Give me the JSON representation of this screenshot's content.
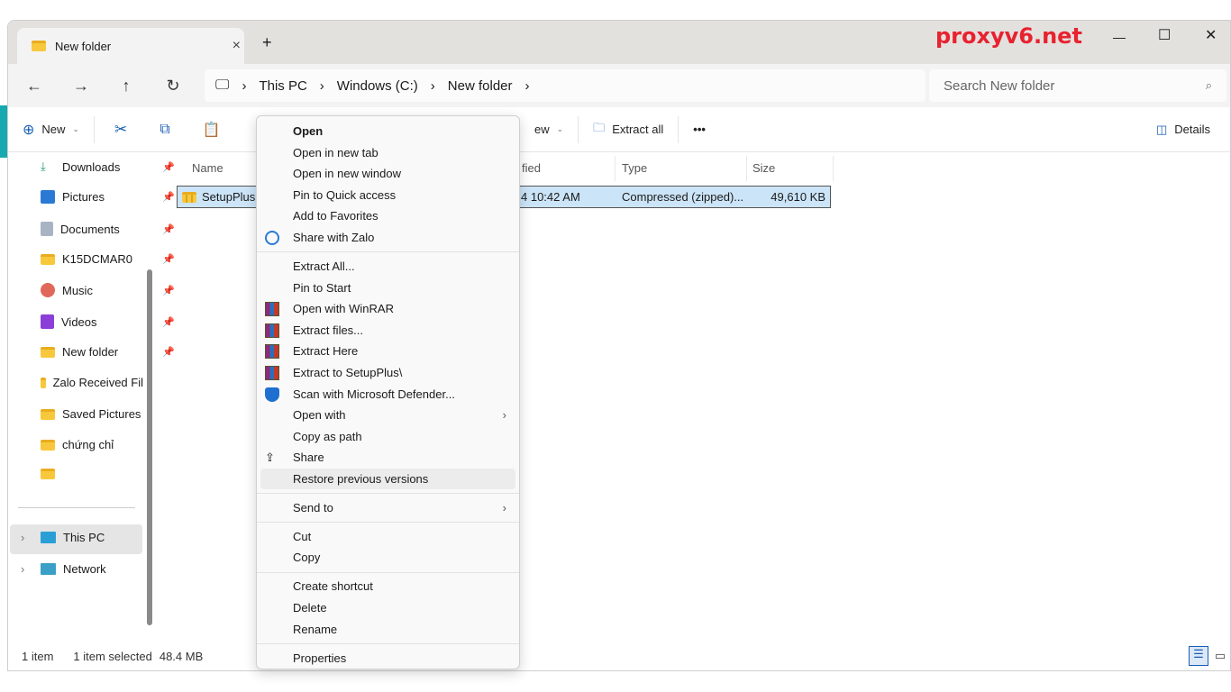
{
  "brand": "proxyv6.net",
  "tab": {
    "title": "New folder",
    "close": "×",
    "new": "+"
  },
  "window": {
    "minimize": "—",
    "maximize": "☐",
    "close": "✕"
  },
  "nav": {
    "back": "←",
    "forward": "→",
    "up": "↑",
    "refresh": "↻"
  },
  "breadcrumb": [
    "This PC",
    "Windows (C:)",
    "New folder"
  ],
  "search": {
    "placeholder": "Search New folder"
  },
  "toolbar": {
    "new": "New",
    "view_partial": "ew",
    "extract_all": "Extract all",
    "more": "•••",
    "details": "Details"
  },
  "sidebar": {
    "items": [
      {
        "label": "Downloads",
        "pinned": true,
        "icon": "download-icon"
      },
      {
        "label": "Pictures",
        "pinned": true,
        "icon": "pictures-icon"
      },
      {
        "label": "Documents",
        "pinned": true,
        "icon": "documents-icon"
      },
      {
        "label": "K15DCMAR0",
        "pinned": true,
        "icon": "folder-icon"
      },
      {
        "label": "Music",
        "pinned": true,
        "icon": "music-icon"
      },
      {
        "label": "Videos",
        "pinned": true,
        "icon": "videos-icon"
      },
      {
        "label": "New folder",
        "pinned": true,
        "icon": "folder-icon"
      },
      {
        "label": "Zalo Received Fil",
        "pinned": false,
        "icon": "folder-icon"
      },
      {
        "label": "Saved Pictures",
        "pinned": false,
        "icon": "folder-icon"
      },
      {
        "label": "chứng chỉ",
        "pinned": false,
        "icon": "folder-icon"
      },
      {
        "label": "",
        "pinned": false,
        "icon": "folder-icon"
      }
    ],
    "this_pc": "This PC",
    "network": "Network"
  },
  "columns": {
    "name": "Name",
    "modified_partial": "fied",
    "type": "Type",
    "size": "Size"
  },
  "file": {
    "name": "SetupPlus",
    "modified_partial": "4 10:42 AM",
    "type": "Compressed (zipped)...",
    "size": "49,610 KB"
  },
  "status": {
    "count": "1 item",
    "selected": "1 item selected",
    "size": "48.4 MB"
  },
  "menu": {
    "groups": [
      [
        {
          "label": "Open",
          "bold": true
        },
        {
          "label": "Open in new tab"
        },
        {
          "label": "Open in new window"
        },
        {
          "label": "Pin to Quick access"
        },
        {
          "label": "Add to Favorites"
        },
        {
          "label": "Share with Zalo",
          "icon": "zalo-icon"
        }
      ],
      [
        {
          "label": "Extract All..."
        },
        {
          "label": "Pin to Start"
        },
        {
          "label": "Open with WinRAR",
          "icon": "winrar-icon"
        },
        {
          "label": "Extract files...",
          "icon": "winrar-icon"
        },
        {
          "label": "Extract Here",
          "icon": "winrar-icon"
        },
        {
          "label": "Extract to SetupPlus\\",
          "icon": "winrar-icon"
        },
        {
          "label": "Scan with Microsoft Defender...",
          "icon": "defender-icon"
        },
        {
          "label": "Open with",
          "submenu": true
        },
        {
          "label": "Copy as path"
        },
        {
          "label": "Share",
          "icon": "share-icon"
        },
        {
          "label": "Restore previous versions",
          "highlighted": true
        }
      ],
      [
        {
          "label": "Send to",
          "submenu": true
        }
      ],
      [
        {
          "label": "Cut"
        },
        {
          "label": "Copy"
        }
      ],
      [
        {
          "label": "Create shortcut"
        },
        {
          "label": "Delete"
        },
        {
          "label": "Rename"
        }
      ],
      [
        {
          "label": "Properties"
        }
      ]
    ]
  }
}
